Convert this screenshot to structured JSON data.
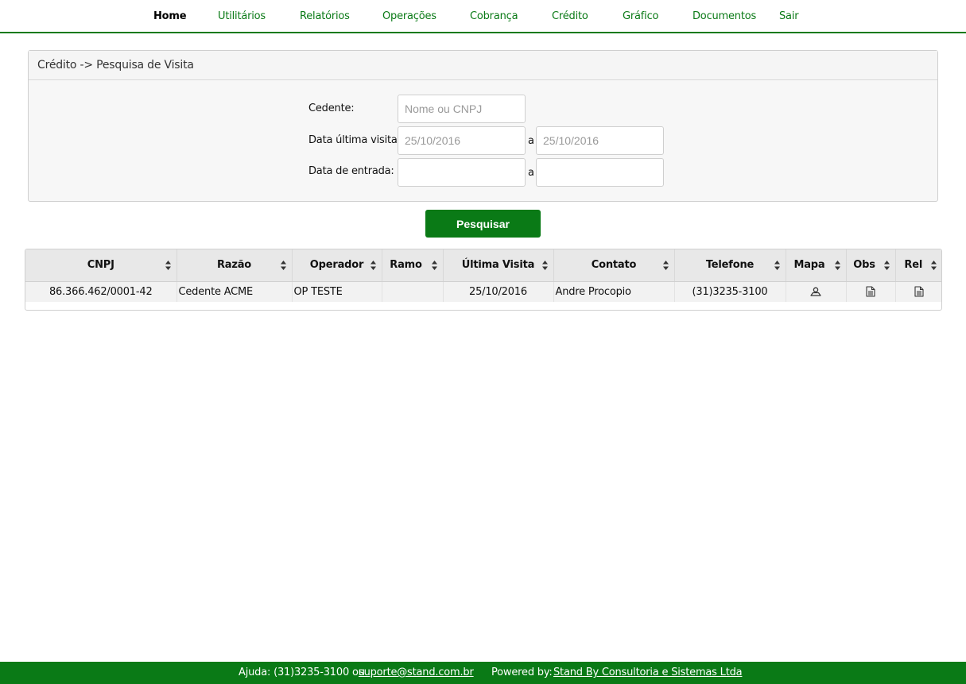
{
  "nav": {
    "items": [
      {
        "label": "Home",
        "active": true
      },
      {
        "label": "Utilitários",
        "active": false
      },
      {
        "label": "Relatórios",
        "active": false
      },
      {
        "label": "Operações",
        "active": false
      },
      {
        "label": "Cobrança",
        "active": false
      },
      {
        "label": "Crédito",
        "active": false
      },
      {
        "label": "Gráfico",
        "active": false
      },
      {
        "label": "Documentos",
        "active": false
      },
      {
        "label": "Sair",
        "active": false
      }
    ]
  },
  "panel": {
    "title": "Crédito -> Pesquisa de Visita",
    "cedente_label": "Cedente:",
    "cedente_placeholder": "Nome ou CNPJ",
    "cedente_value": "",
    "ultima_visita_label": "Data última visita:",
    "ultima_visita_from": "25/10/2016",
    "ultima_visita_to": "25/10/2016",
    "entrada_label": "Data de entrada:",
    "entrada_from": "",
    "entrada_to": "",
    "range_sep": "a"
  },
  "search_button": "Pesquisar",
  "table": {
    "headers": [
      "CNPJ",
      "Razão",
      "Operador",
      "Ramo",
      "Última Visita",
      "Contato",
      "Telefone",
      "Mapa",
      "Obs",
      "Rel"
    ],
    "rows": [
      {
        "cnpj": "86.366.462/0001-42",
        "razao": "Cedente ACME",
        "operador": "OP TESTE",
        "ramo": "",
        "ultima_visita": "25/10/2016",
        "contato": "Andre Procopio",
        "telefone": "(31)3235-3100"
      }
    ]
  },
  "footer": {
    "help_prefix": "Ajuda: (31)3235-3100 ou",
    "help_email": "suporte@stand.com.br",
    "powered_prefix": "Powered by:",
    "powered_link": "Stand By Consultoria e Sistemas Ltda"
  },
  "colors": {
    "brand_green": "#0a7a16"
  },
  "icons": {
    "sort": "sort-both-icon",
    "mapa": "map-pin-icon",
    "obs": "document-icon",
    "rel": "document-icon"
  }
}
